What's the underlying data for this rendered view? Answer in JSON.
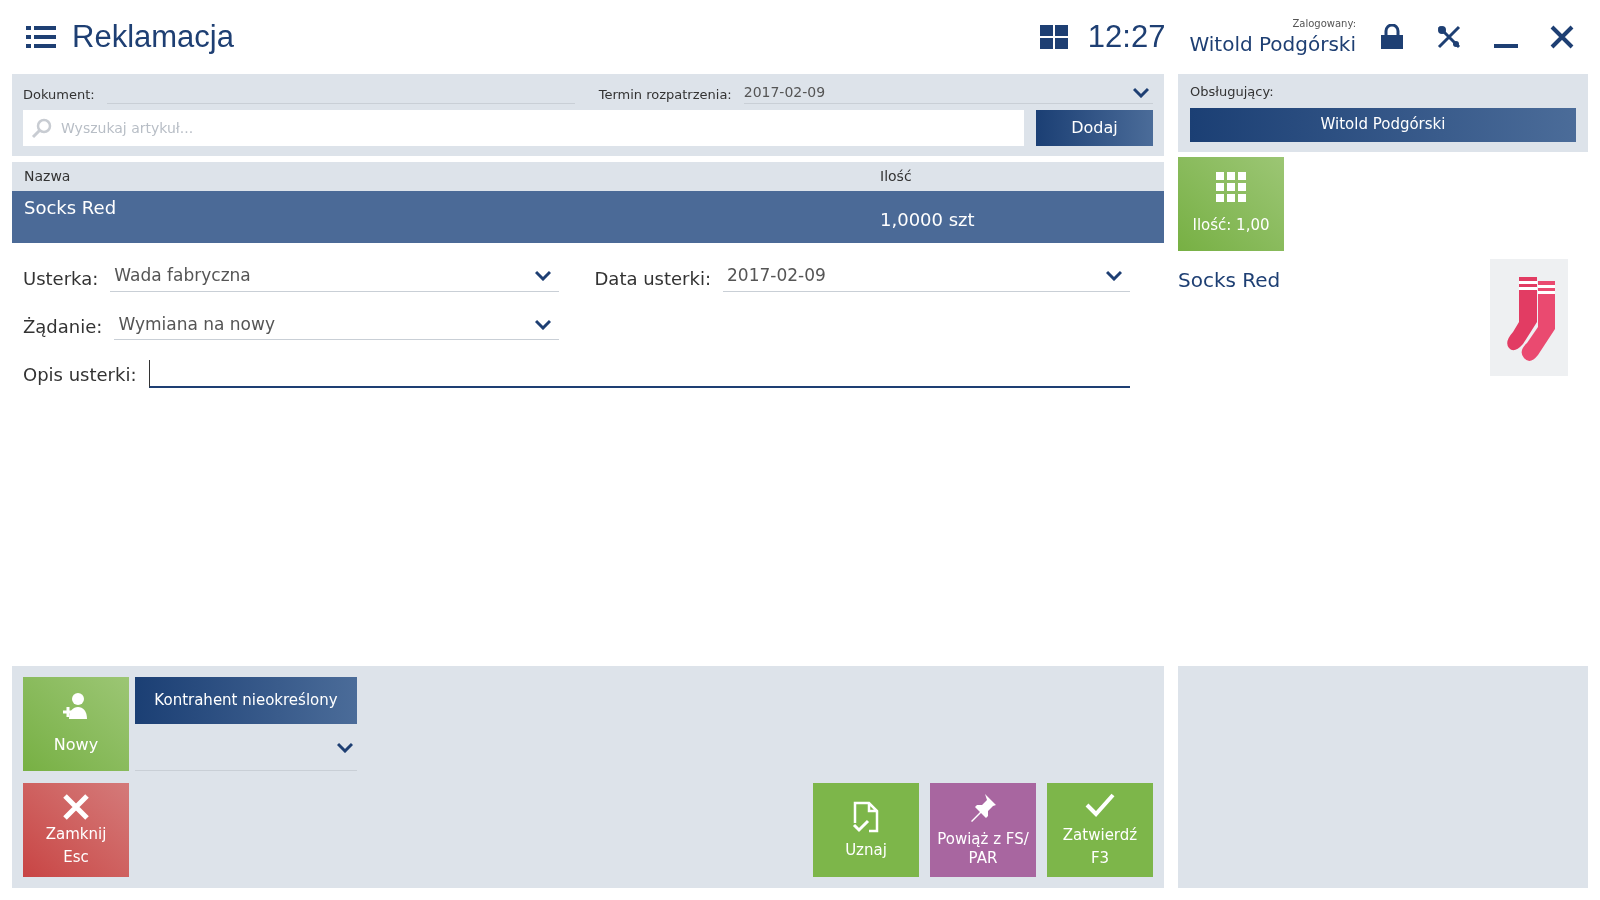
{
  "header": {
    "title": "Reklamacja",
    "time": "12:27",
    "logged_label": "Zalogowany:",
    "user": "Witold Podgórski"
  },
  "document": {
    "document_label": "Dokument:",
    "deadline_label": "Termin rozpatrzenia:",
    "deadline_value": "2017-02-09",
    "search_placeholder": "Wyszukaj artykuł...",
    "add_button": "Dodaj"
  },
  "table": {
    "columns": [
      "Nazwa",
      "Ilość"
    ],
    "rows": [
      {
        "name": "Socks Red",
        "quantity": "1,0000 szt",
        "selected": true
      }
    ]
  },
  "fields": [
    {
      "kind": "dropdown",
      "label": "Usterka:",
      "value": "Wada fabryczna"
    },
    {
      "kind": "dropdown",
      "label": "Data usterki:",
      "value": "2017-02-09"
    },
    {
      "kind": "dropdown",
      "label": "Żądanie:",
      "value": "Wymiana na nowy"
    },
    {
      "kind": "text",
      "label": "Opis usterki:",
      "focused": true
    }
  ],
  "customer": {
    "new_button": "Nowy",
    "customer_button": "Kontrahent nieokreślony"
  },
  "close_button": {
    "label": "Zamknij",
    "shortcut": "Esc"
  },
  "actions": [
    {
      "kind": "accept",
      "label": "Uznaj",
      "color": "#7db64a"
    },
    {
      "kind": "link",
      "label": "Powiąż z FS/ PAR",
      "color": "#a866a0"
    },
    {
      "kind": "confirm",
      "label": "Zatwierdź",
      "shortcut": "F3",
      "color": "#7db64a"
    }
  ],
  "side": {
    "handler_label": "Obsługujący:",
    "handler": "Witold Podgórski",
    "quantity_tile": "Ilość: 1,00",
    "product_name": "Socks Red"
  }
}
